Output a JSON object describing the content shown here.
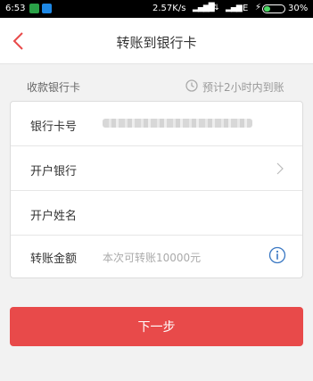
{
  "status_bar": {
    "time": "6:53",
    "speed": "2.57K/s",
    "network": "E",
    "battery_percent": "30%",
    "battery_level": 0.3
  },
  "header": {
    "title": "转账到银行卡",
    "back_icon": "chevron-left-icon"
  },
  "section": {
    "label": "收款银行卡",
    "estimate": "预计2小时内到账",
    "clock_icon": "clock-icon"
  },
  "form": {
    "card_number_label": "银行卡号",
    "bank_label": "开户银行",
    "name_label": "开户姓名",
    "amount_label": "转账金额",
    "amount_placeholder": "本次可转账10000元"
  },
  "next_button": {
    "label": "下一步"
  },
  "colors": {
    "accent": "#e84a4a",
    "info": "#3a78c3",
    "background": "#f2f2f2"
  }
}
